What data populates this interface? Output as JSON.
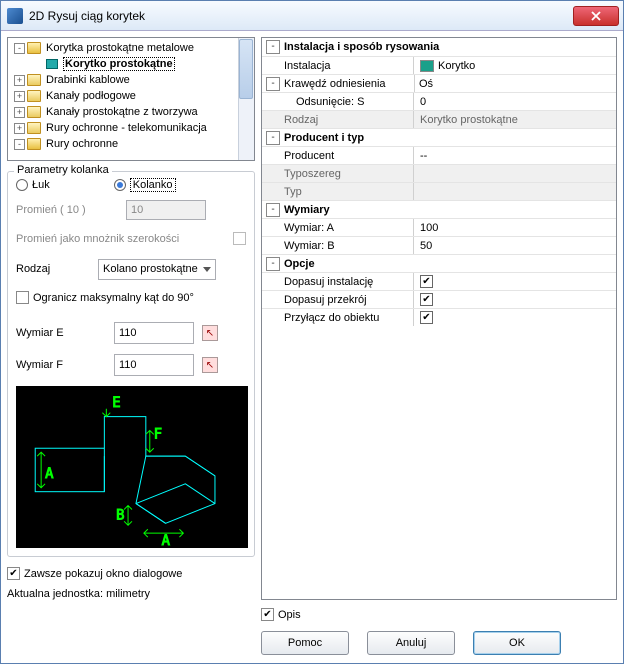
{
  "window": {
    "title": "2D Rysuj ciąg korytek"
  },
  "tree": {
    "items": [
      {
        "label": "Korytka prostokątne metalowe",
        "type": "folder-open",
        "toggle": "-",
        "indent": 0
      },
      {
        "label": "Korytko prostokątne",
        "type": "item",
        "indent": 2,
        "selected": true
      },
      {
        "label": "Drabinki kablowe",
        "type": "folder-closed",
        "toggle": "+",
        "indent": 0
      },
      {
        "label": "Kanały podłogowe",
        "type": "folder-closed",
        "toggle": "+",
        "indent": 0
      },
      {
        "label": "Kanały prostokątne z tworzywa",
        "type": "folder-closed",
        "toggle": "+",
        "indent": 0
      },
      {
        "label": "Rury ochronne - telekomunikacja",
        "type": "folder-closed",
        "toggle": "+",
        "indent": 0
      },
      {
        "label": "Rury ochronne",
        "type": "folder-open",
        "toggle": "-",
        "indent": 0
      }
    ]
  },
  "params_group": {
    "title": "Parametry kolanka",
    "radio_arc": "Łuk",
    "radio_elbow": "Kolanko",
    "radius_label": "Promień ( 10 )",
    "radius_value": "10",
    "multiplier_label": "Promień jako mnożnik szerokości",
    "kind_label": "Rodzaj",
    "kind_value": "Kolano prostokątne",
    "limit90_label": "Ogranicz maksymalny kąt do 90°",
    "dim_e_label": "Wymiar E",
    "dim_e_value": "110",
    "dim_f_label": "Wymiar F",
    "dim_f_value": "110"
  },
  "always_show_label": "Zawsze pokazuj okno dialogowe",
  "unit_text": "Aktualna jednostka: milimetry",
  "propgrid": {
    "s1_title": "Instalacja i sposób rysowania",
    "r1_key": "Instalacja",
    "r1_val": "Korytko",
    "r2_key": "Krawędź odniesienia",
    "r2_val": "Oś",
    "r3_key": "Odsunięcie: S",
    "r3_val": "0",
    "r4_key": "Rodzaj",
    "r4_val": "Korytko prostokątne",
    "s2_title": "Producent i typ",
    "r5_key": "Producent",
    "r5_val": "--",
    "r6_key": "Typoszereg",
    "r6_val": "",
    "r7_key": "Typ",
    "r7_val": "",
    "s3_title": "Wymiary",
    "r8_key": "Wymiar: A",
    "r8_val": "100",
    "r9_key": "Wymiar: B",
    "r9_val": "50",
    "s4_title": "Opcje",
    "r10_key": "Dopasuj instalację",
    "r11_key": "Dopasuj przekrój",
    "r12_key": "Przyłącz do obiektu"
  },
  "opis_label": "Opis",
  "buttons": {
    "help": "Pomoc",
    "cancel": "Anuluj",
    "ok": "OK"
  },
  "chart_data": {
    "type": "diagram",
    "description": "CAD-style preview of rectangular cable-tray elbow with dimension letters",
    "labels": [
      "E",
      "F",
      "A",
      "A",
      "B"
    ],
    "colors": {
      "outline": "#00ffff",
      "labels": "#00ff00",
      "background": "#000000"
    }
  }
}
